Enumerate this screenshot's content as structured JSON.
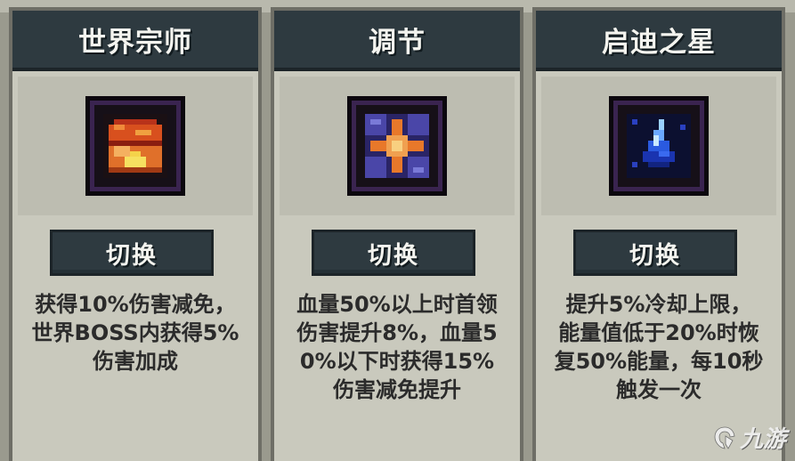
{
  "cards": [
    {
      "title": "世界宗师",
      "icon": "world-master-chest-icon",
      "button_label": "切换",
      "description": "获得10%伤害减免，\n世界BOSS内获得5%\n伤害加成"
    },
    {
      "title": "调节",
      "icon": "regulate-cross-icon",
      "button_label": "切换",
      "description": "血量50%以上时首领\n伤害提升8%，血量5\n0%以下时获得15%\n伤害减免提升"
    },
    {
      "title": "启迪之星",
      "icon": "star-of-enlightenment-crystal-icon",
      "button_label": "切换",
      "description": "提升5%冷却上限，\n能量值低于20%时恢\n复50%能量，每10秒\n触发一次"
    }
  ],
  "watermark": {
    "text": "九游",
    "icon": "jiuyou-logo-icon"
  },
  "colors": {
    "header": "#2e3a40",
    "card_bg": "#c9c9bd",
    "text": "#2b2b2b"
  }
}
